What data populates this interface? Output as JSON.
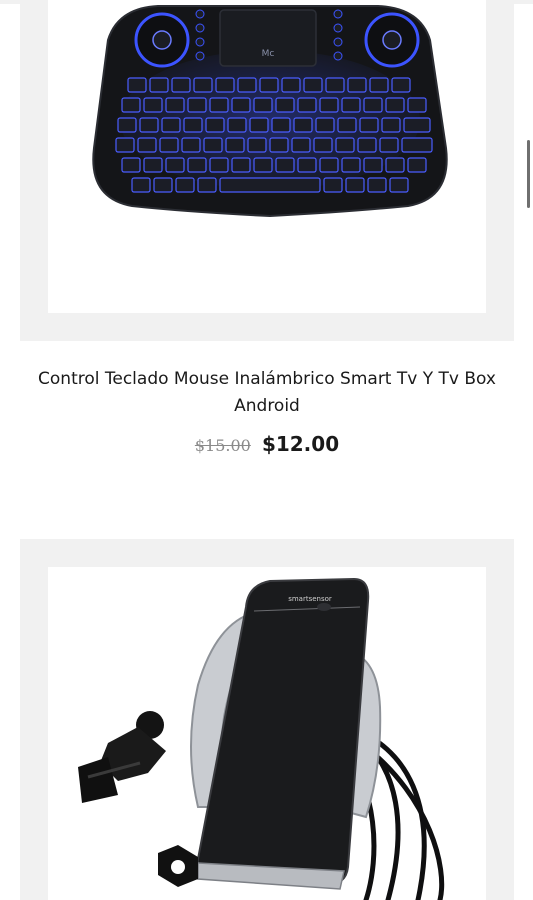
{
  "products": [
    {
      "name": "Control Teclado Mouse Inalámbrico Smart Tv Y Tv Box Android",
      "old_price": "$15.00",
      "price": "$12.00",
      "image_icon": "wireless-keyboard-icon",
      "image_brand_text": "Mc"
    },
    {
      "image_icon": "car-phone-holder-icon",
      "image_brand_text": "smartsensor"
    }
  ],
  "colors": {
    "frame": "#f1f1f1",
    "keyboard_body": "#141518",
    "key_glow": "#3c54ff",
    "text": "#1a1a1a",
    "muted_price": "#8a8a8a"
  }
}
